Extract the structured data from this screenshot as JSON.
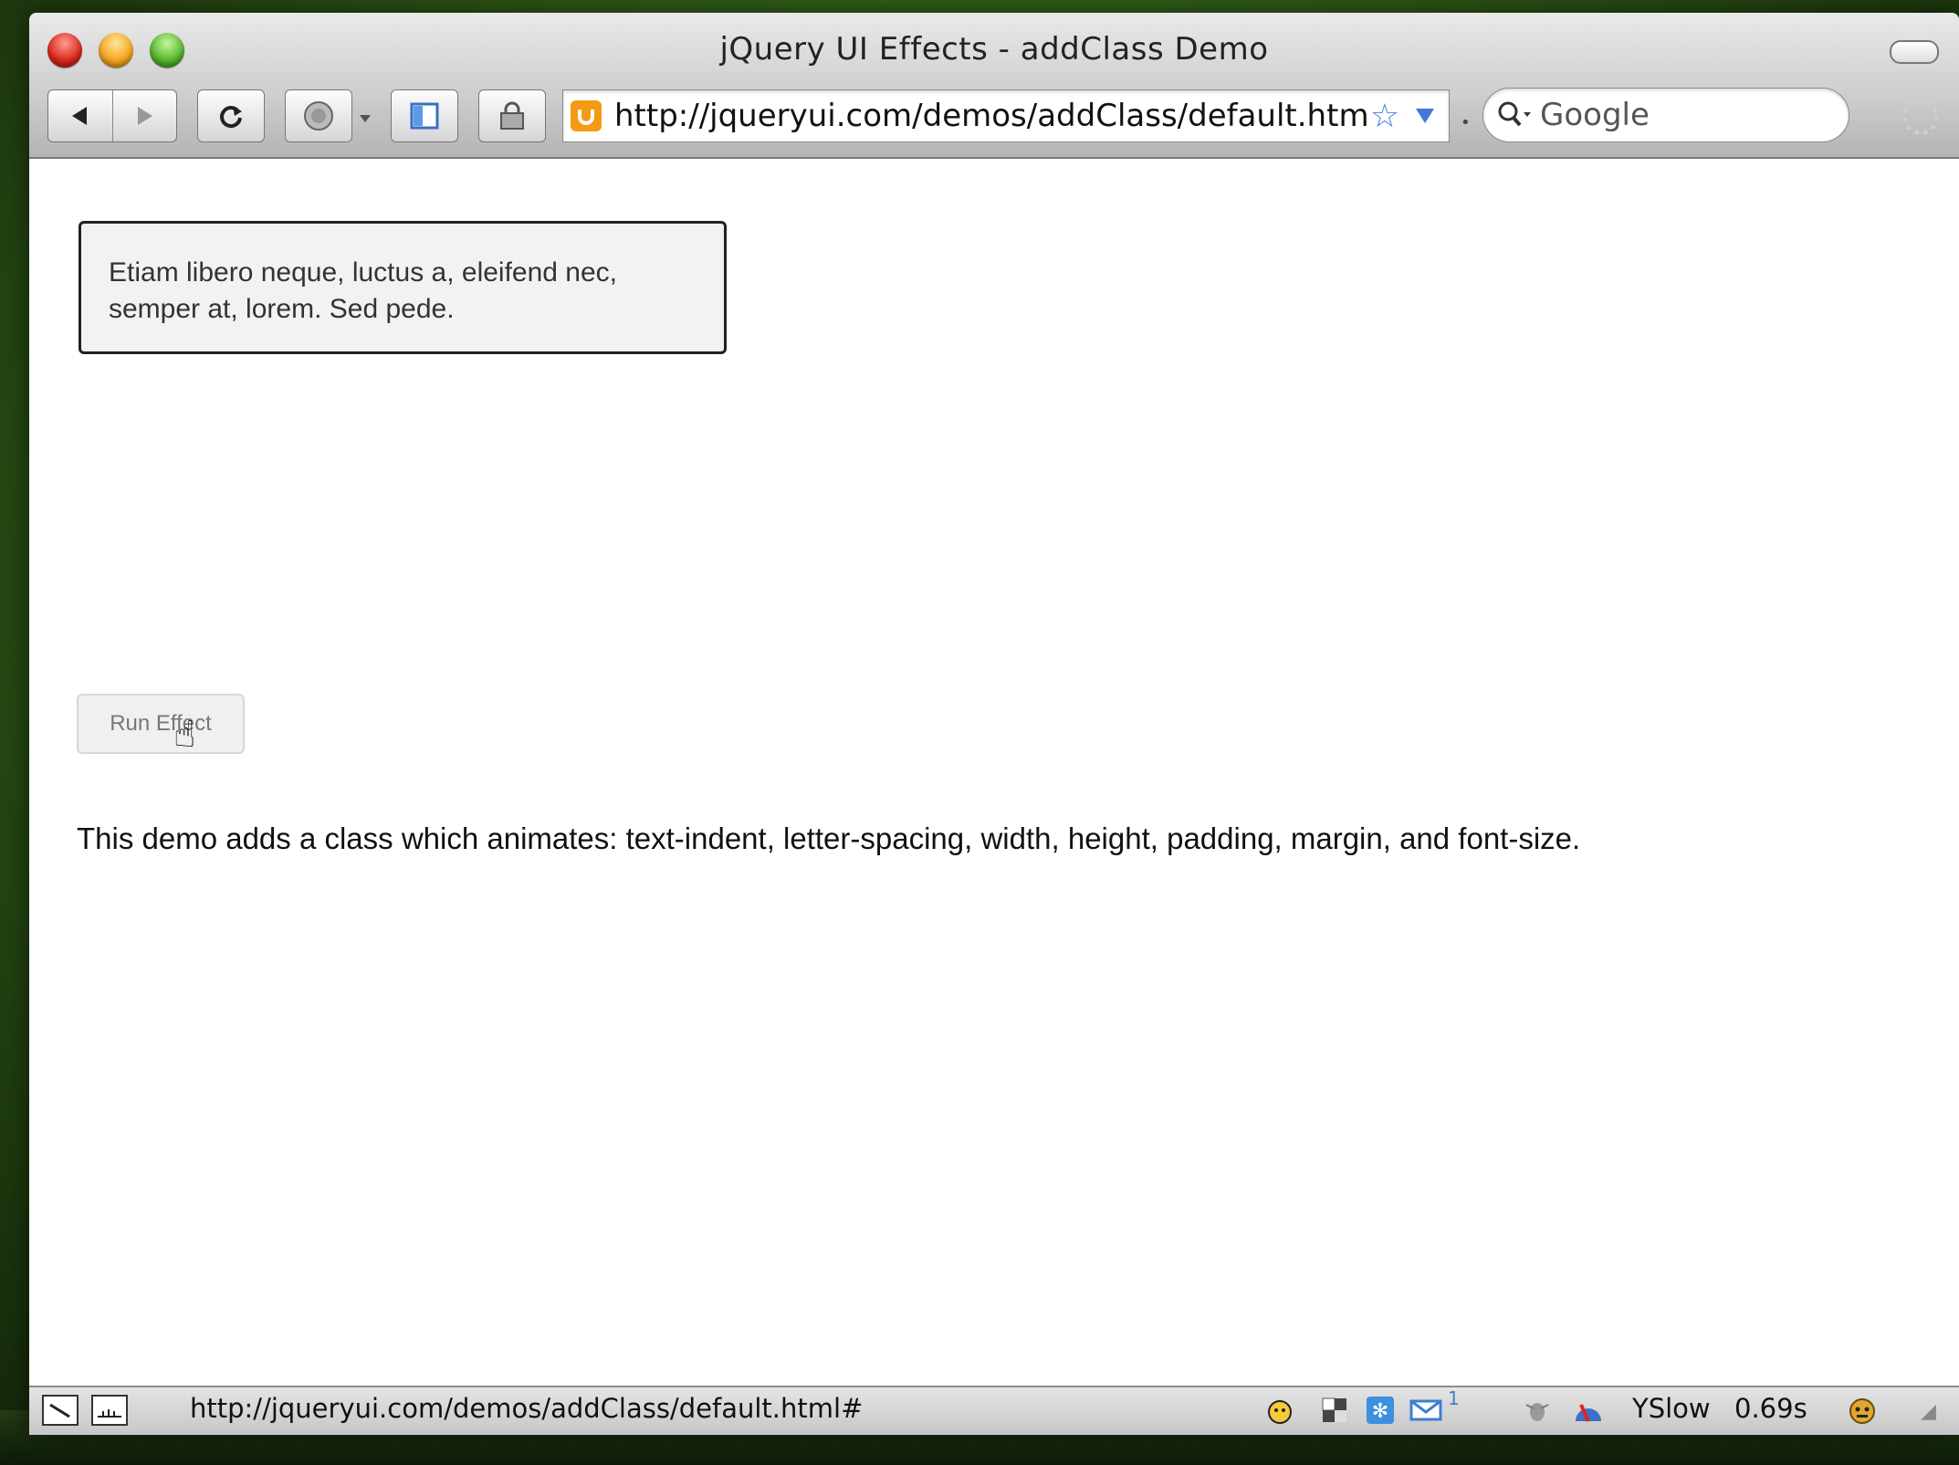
{
  "window": {
    "title": "jQuery UI Effects - addClass Demo"
  },
  "toolbar": {
    "url": "http://jqueryui.com/demos/addClass/default.html",
    "search_placeholder": "Google",
    "icons": [
      "back-arrow-icon",
      "forward-arrow-icon",
      "reload-icon",
      "home-icon",
      "bookmark-sidebar-icon",
      "lock-icon",
      "star-icon",
      "search-icon"
    ]
  },
  "content": {
    "demo_text": "Etiam libero neque, luctus a, eleifend nec, semper at, lorem. Sed pede.",
    "run_button_label": "Run Effect",
    "description": "This demo adds a class which animates: text-indent, letter-spacing, width, height, padding, margin, and font-size."
  },
  "statusbar": {
    "status_url": "http://jqueryui.com/demos/addClass/default.html#",
    "mail_count": "1",
    "yslow_label": "YSlow",
    "load_time": "0.69s"
  },
  "colors": {
    "site_icon": "#f59a14",
    "star": "#4c7ed8",
    "demo_box_bg": "#f2f2f2"
  }
}
